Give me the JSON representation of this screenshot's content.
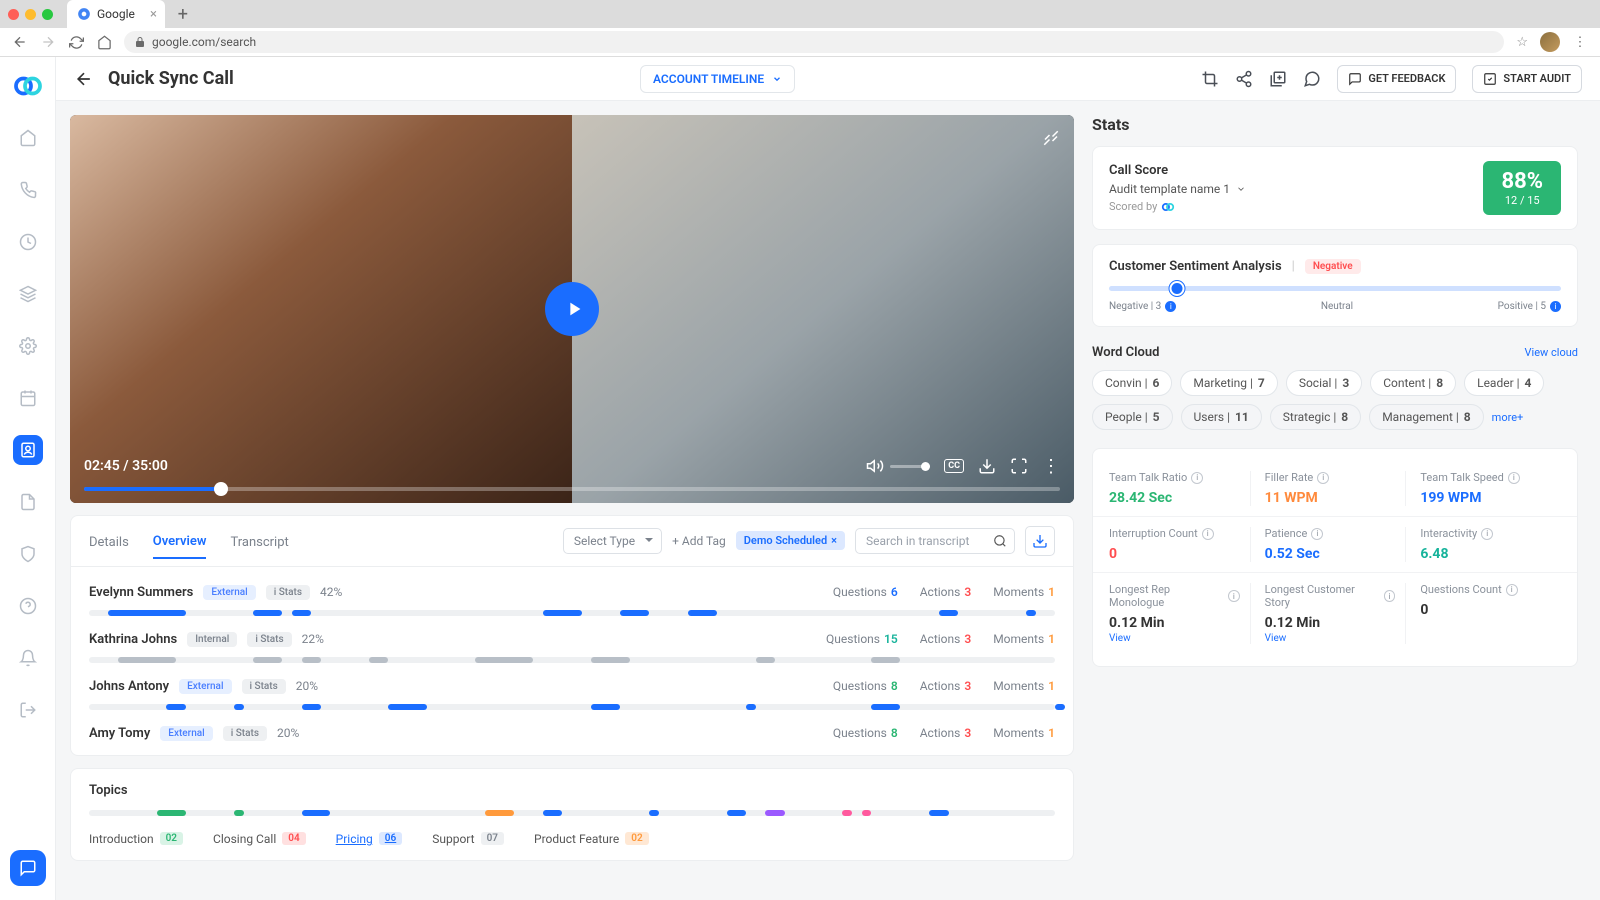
{
  "browser": {
    "tab_title": "Google",
    "url": "google.com/search"
  },
  "header": {
    "title": "Quick Sync Call",
    "timeline_label": "ACCOUNT TIMELINE",
    "get_feedback": "GET FEEDBACK",
    "start_audit": "START AUDIT"
  },
  "video": {
    "time": "02:45 / 35:00",
    "cc": "CC"
  },
  "tabs": {
    "details": "Details",
    "overview": "Overview",
    "transcript": "Transcript",
    "select_type": "Select Type",
    "add_tag": "+  Add Tag",
    "chip": "Demo Scheduled",
    "search_ph": "Search in transcript"
  },
  "speakers": [
    {
      "name": "Evelynn Summers",
      "type": "External",
      "stats": "i Stats",
      "pct": "42%",
      "q": "6",
      "a": "3",
      "m": "1",
      "color": "b",
      "segs": [
        [
          2,
          8
        ],
        [
          17,
          3
        ],
        [
          21,
          2
        ],
        [
          47,
          4
        ],
        [
          55,
          3
        ],
        [
          62,
          3
        ],
        [
          88,
          2
        ],
        [
          97,
          1
        ]
      ]
    },
    {
      "name": "Kathrina Johns",
      "type": "Internal",
      "stats": "i Stats",
      "pct": "22%",
      "q": "15",
      "a": "3",
      "m": "1",
      "color": "g",
      "segs": [
        [
          3,
          6
        ],
        [
          17,
          3
        ],
        [
          22,
          2
        ],
        [
          29,
          2
        ],
        [
          40,
          6
        ],
        [
          52,
          4
        ],
        [
          69,
          2
        ],
        [
          81,
          3
        ]
      ]
    },
    {
      "name": "Johns Antony",
      "type": "External",
      "stats": "i Stats",
      "pct": "20%",
      "q": "8",
      "a": "3",
      "m": "1",
      "color": "b",
      "segs": [
        [
          8,
          2
        ],
        [
          15,
          1
        ],
        [
          22,
          2
        ],
        [
          31,
          4
        ],
        [
          52,
          3
        ],
        [
          68,
          1
        ],
        [
          81,
          3
        ],
        [
          100,
          1
        ]
      ]
    },
    {
      "name": "Amy Tomy",
      "type": "External",
      "stats": "i Stats",
      "pct": "20%",
      "q": "8",
      "a": "3",
      "m": "1",
      "color": "b",
      "segs": []
    }
  ],
  "qam_labels": {
    "q": "Questions",
    "a": "Actions",
    "m": "Moments"
  },
  "topics": {
    "title": "Topics",
    "items": [
      {
        "label": "Introduction",
        "count": "02",
        "cls": "tc-grn"
      },
      {
        "label": "Closing Call",
        "count": "04",
        "cls": "tc-red"
      },
      {
        "label": "Pricing",
        "count": "06",
        "cls": "tc-blu",
        "active": true
      },
      {
        "label": "Support",
        "count": "07",
        "cls": "tc-gry"
      },
      {
        "label": "Product Feature",
        "count": "02",
        "cls": "tc-org"
      }
    ]
  },
  "stats": {
    "title": "Stats",
    "call_score": "Call Score",
    "template": "Audit template name 1",
    "scored_by": "Scored by",
    "pct": "88%",
    "frac": "12 / 15",
    "sentiment": {
      "title": "Customer Sentiment Analysis",
      "badge": "Negative",
      "neg": "Negative | 3",
      "neu": "Neutral",
      "pos": "Positive | 5"
    },
    "wordcloud": {
      "title": "Word Cloud",
      "link": "View cloud",
      "more": "more+",
      "pills": [
        {
          "t": "Convin",
          "n": "6"
        },
        {
          "t": "Marketing",
          "n": "7"
        },
        {
          "t": "Social",
          "n": "3"
        },
        {
          "t": "Content",
          "n": "8"
        },
        {
          "t": "Leader",
          "n": "4"
        },
        {
          "t": "People",
          "n": "5",
          "sub": true
        },
        {
          "t": "Users",
          "n": "11",
          "sub": true
        },
        {
          "t": "Strategic",
          "n": "8",
          "sub": true
        },
        {
          "t": "Management",
          "n": "8",
          "sub": true
        }
      ]
    },
    "metrics": [
      [
        {
          "l": "Team Talk Ratio",
          "v": "28.42 Sec",
          "c": "green"
        },
        {
          "l": "Filler Rate",
          "v": "11 WPM",
          "c": "orange"
        },
        {
          "l": "Team Talk Speed",
          "v": "199 WPM",
          "c": "blue"
        }
      ],
      [
        {
          "l": "Interruption Count",
          "v": "0",
          "c": "red"
        },
        {
          "l": "Patience",
          "v": "0.52 Sec",
          "c": "blue"
        },
        {
          "l": "Interactivity",
          "v": "6.48",
          "c": "teal"
        }
      ],
      [
        {
          "l": "Longest Rep Monologue",
          "v": "0.12 Min",
          "c": "dark",
          "link": "View"
        },
        {
          "l": "Longest Customer Story",
          "v": "0.12 Min",
          "c": "dark",
          "link": "View"
        },
        {
          "l": "Questions Count",
          "v": "0",
          "c": "dark"
        }
      ]
    ]
  }
}
